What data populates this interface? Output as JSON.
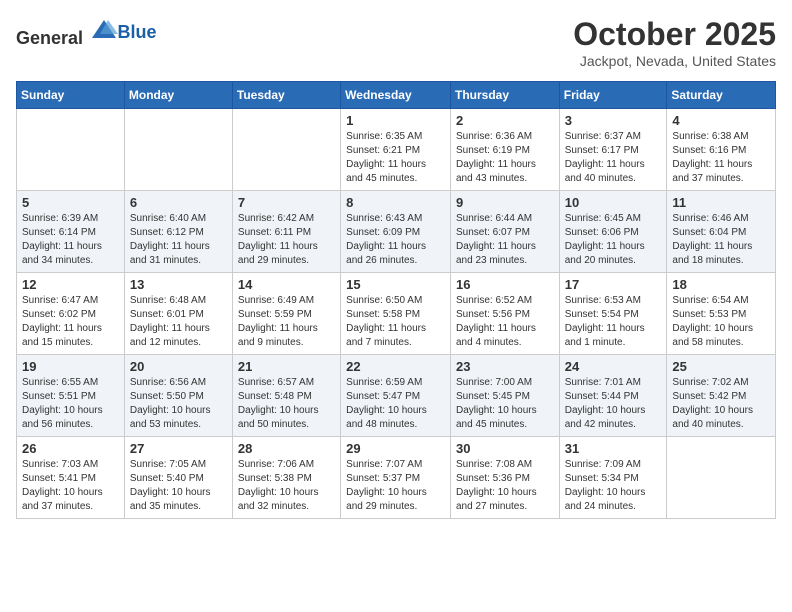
{
  "header": {
    "logo_general": "General",
    "logo_blue": "Blue",
    "month": "October 2025",
    "location": "Jackpot, Nevada, United States"
  },
  "weekdays": [
    "Sunday",
    "Monday",
    "Tuesday",
    "Wednesday",
    "Thursday",
    "Friday",
    "Saturday"
  ],
  "weeks": [
    [
      {
        "day": "",
        "info": ""
      },
      {
        "day": "",
        "info": ""
      },
      {
        "day": "",
        "info": ""
      },
      {
        "day": "1",
        "info": "Sunrise: 6:35 AM\nSunset: 6:21 PM\nDaylight: 11 hours\nand 45 minutes."
      },
      {
        "day": "2",
        "info": "Sunrise: 6:36 AM\nSunset: 6:19 PM\nDaylight: 11 hours\nand 43 minutes."
      },
      {
        "day": "3",
        "info": "Sunrise: 6:37 AM\nSunset: 6:17 PM\nDaylight: 11 hours\nand 40 minutes."
      },
      {
        "day": "4",
        "info": "Sunrise: 6:38 AM\nSunset: 6:16 PM\nDaylight: 11 hours\nand 37 minutes."
      }
    ],
    [
      {
        "day": "5",
        "info": "Sunrise: 6:39 AM\nSunset: 6:14 PM\nDaylight: 11 hours\nand 34 minutes."
      },
      {
        "day": "6",
        "info": "Sunrise: 6:40 AM\nSunset: 6:12 PM\nDaylight: 11 hours\nand 31 minutes."
      },
      {
        "day": "7",
        "info": "Sunrise: 6:42 AM\nSunset: 6:11 PM\nDaylight: 11 hours\nand 29 minutes."
      },
      {
        "day": "8",
        "info": "Sunrise: 6:43 AM\nSunset: 6:09 PM\nDaylight: 11 hours\nand 26 minutes."
      },
      {
        "day": "9",
        "info": "Sunrise: 6:44 AM\nSunset: 6:07 PM\nDaylight: 11 hours\nand 23 minutes."
      },
      {
        "day": "10",
        "info": "Sunrise: 6:45 AM\nSunset: 6:06 PM\nDaylight: 11 hours\nand 20 minutes."
      },
      {
        "day": "11",
        "info": "Sunrise: 6:46 AM\nSunset: 6:04 PM\nDaylight: 11 hours\nand 18 minutes."
      }
    ],
    [
      {
        "day": "12",
        "info": "Sunrise: 6:47 AM\nSunset: 6:02 PM\nDaylight: 11 hours\nand 15 minutes."
      },
      {
        "day": "13",
        "info": "Sunrise: 6:48 AM\nSunset: 6:01 PM\nDaylight: 11 hours\nand 12 minutes."
      },
      {
        "day": "14",
        "info": "Sunrise: 6:49 AM\nSunset: 5:59 PM\nDaylight: 11 hours\nand 9 minutes."
      },
      {
        "day": "15",
        "info": "Sunrise: 6:50 AM\nSunset: 5:58 PM\nDaylight: 11 hours\nand 7 minutes."
      },
      {
        "day": "16",
        "info": "Sunrise: 6:52 AM\nSunset: 5:56 PM\nDaylight: 11 hours\nand 4 minutes."
      },
      {
        "day": "17",
        "info": "Sunrise: 6:53 AM\nSunset: 5:54 PM\nDaylight: 11 hours\nand 1 minute."
      },
      {
        "day": "18",
        "info": "Sunrise: 6:54 AM\nSunset: 5:53 PM\nDaylight: 10 hours\nand 58 minutes."
      }
    ],
    [
      {
        "day": "19",
        "info": "Sunrise: 6:55 AM\nSunset: 5:51 PM\nDaylight: 10 hours\nand 56 minutes."
      },
      {
        "day": "20",
        "info": "Sunrise: 6:56 AM\nSunset: 5:50 PM\nDaylight: 10 hours\nand 53 minutes."
      },
      {
        "day": "21",
        "info": "Sunrise: 6:57 AM\nSunset: 5:48 PM\nDaylight: 10 hours\nand 50 minutes."
      },
      {
        "day": "22",
        "info": "Sunrise: 6:59 AM\nSunset: 5:47 PM\nDaylight: 10 hours\nand 48 minutes."
      },
      {
        "day": "23",
        "info": "Sunrise: 7:00 AM\nSunset: 5:45 PM\nDaylight: 10 hours\nand 45 minutes."
      },
      {
        "day": "24",
        "info": "Sunrise: 7:01 AM\nSunset: 5:44 PM\nDaylight: 10 hours\nand 42 minutes."
      },
      {
        "day": "25",
        "info": "Sunrise: 7:02 AM\nSunset: 5:42 PM\nDaylight: 10 hours\nand 40 minutes."
      }
    ],
    [
      {
        "day": "26",
        "info": "Sunrise: 7:03 AM\nSunset: 5:41 PM\nDaylight: 10 hours\nand 37 minutes."
      },
      {
        "day": "27",
        "info": "Sunrise: 7:05 AM\nSunset: 5:40 PM\nDaylight: 10 hours\nand 35 minutes."
      },
      {
        "day": "28",
        "info": "Sunrise: 7:06 AM\nSunset: 5:38 PM\nDaylight: 10 hours\nand 32 minutes."
      },
      {
        "day": "29",
        "info": "Sunrise: 7:07 AM\nSunset: 5:37 PM\nDaylight: 10 hours\nand 29 minutes."
      },
      {
        "day": "30",
        "info": "Sunrise: 7:08 AM\nSunset: 5:36 PM\nDaylight: 10 hours\nand 27 minutes."
      },
      {
        "day": "31",
        "info": "Sunrise: 7:09 AM\nSunset: 5:34 PM\nDaylight: 10 hours\nand 24 minutes."
      },
      {
        "day": "",
        "info": ""
      }
    ]
  ]
}
